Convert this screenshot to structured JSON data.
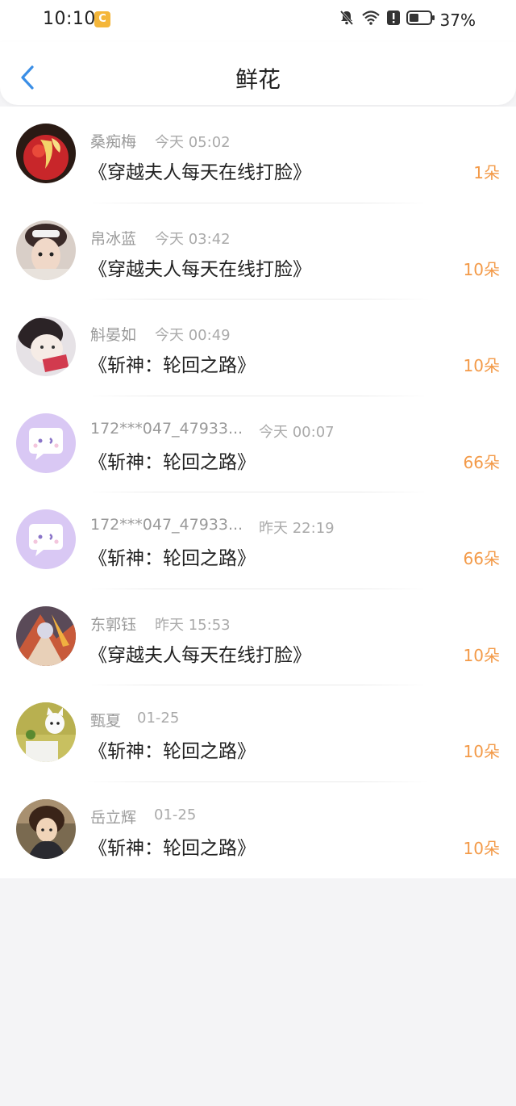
{
  "status_bar": {
    "time": "10:10",
    "battery": "37%",
    "app_badge": "C"
  },
  "header": {
    "title": "鲜花"
  },
  "colors": {
    "accent": "#3a8ee6",
    "count": "#f39a48",
    "avatar_placeholder": "#d9c8f4"
  },
  "items": [
    {
      "name": "桑痴梅",
      "time": "今天 05:02",
      "book": "《穿越夫人每天在线打脸》",
      "count": "1朵",
      "avatar": "apple"
    },
    {
      "name": "帛冰蓝",
      "time": "今天 03:42",
      "book": "《穿越夫人每天在线打脸》",
      "count": "10朵",
      "avatar": "photo"
    },
    {
      "name": "斛晏如",
      "time": "今天 00:49",
      "book": "《斩神：轮回之路》",
      "count": "10朵",
      "avatar": "photo"
    },
    {
      "name": "172***047_47933...",
      "time": "今天 00:07",
      "book": "《斩神：轮回之路》",
      "count": "66朵",
      "avatar": "default"
    },
    {
      "name": "172***047_47933...",
      "time": "昨天 22:19",
      "book": "《斩神：轮回之路》",
      "count": "66朵",
      "avatar": "default"
    },
    {
      "name": "东郭钰",
      "time": "昨天 15:53",
      "book": "《穿越夫人每天在线打脸》",
      "count": "10朵",
      "avatar": "photo"
    },
    {
      "name": "甄夏",
      "time": "01-25",
      "book": "《斩神：轮回之路》",
      "count": "10朵",
      "avatar": "photo"
    },
    {
      "name": "岳立辉",
      "time": "01-25",
      "book": "《斩神：轮回之路》",
      "count": "10朵",
      "avatar": "photo"
    }
  ]
}
